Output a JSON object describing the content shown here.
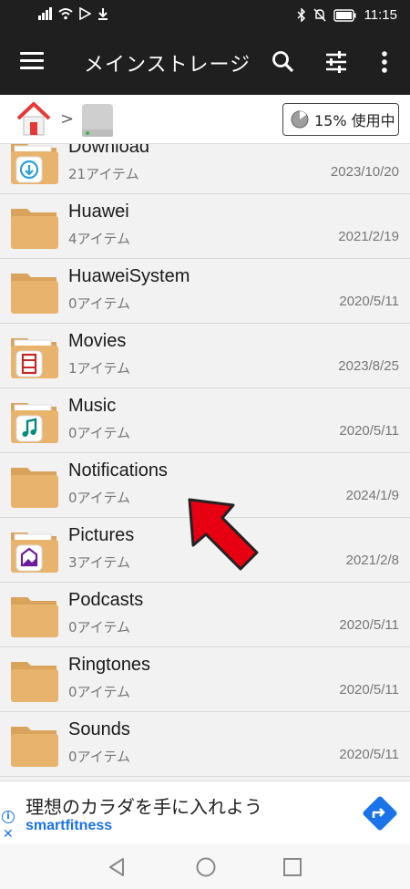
{
  "status": {
    "time": "11:15",
    "battery": "100"
  },
  "toolbar": {
    "title": "メインストレージ"
  },
  "path": {
    "usage": "15% 使用中",
    "usage_fraction": 0.15
  },
  "folders": [
    {
      "name": "Download",
      "count": "21アイテム",
      "date": "2023/10/20",
      "badge": "download"
    },
    {
      "name": "Huawei",
      "count": "4アイテム",
      "date": "2021/2/19",
      "badge": "none"
    },
    {
      "name": "HuaweiSystem",
      "count": "0アイテム",
      "date": "2020/5/11",
      "badge": "none"
    },
    {
      "name": "Movies",
      "count": "1アイテム",
      "date": "2023/8/25",
      "badge": "movie"
    },
    {
      "name": "Music",
      "count": "0アイテム",
      "date": "2020/5/11",
      "badge": "music"
    },
    {
      "name": "Notifications",
      "count": "0アイテム",
      "date": "2024/1/9",
      "badge": "none"
    },
    {
      "name": "Pictures",
      "count": "3アイテム",
      "date": "2021/2/8",
      "badge": "picture"
    },
    {
      "name": "Podcasts",
      "count": "0アイテム",
      "date": "2020/5/11",
      "badge": "none"
    },
    {
      "name": "Ringtones",
      "count": "0アイテム",
      "date": "2020/5/11",
      "badge": "none"
    },
    {
      "name": "Sounds",
      "count": "0アイテム",
      "date": "2020/5/11",
      "badge": "none"
    }
  ],
  "ad": {
    "title": "理想のカラダを手に入れよう",
    "brand": "smartfitness"
  },
  "colors": {
    "folder": "#e8b36c",
    "folder_dark": "#d9a35c",
    "toolbar": "#1f1f1f",
    "arrow": "#e60012"
  }
}
